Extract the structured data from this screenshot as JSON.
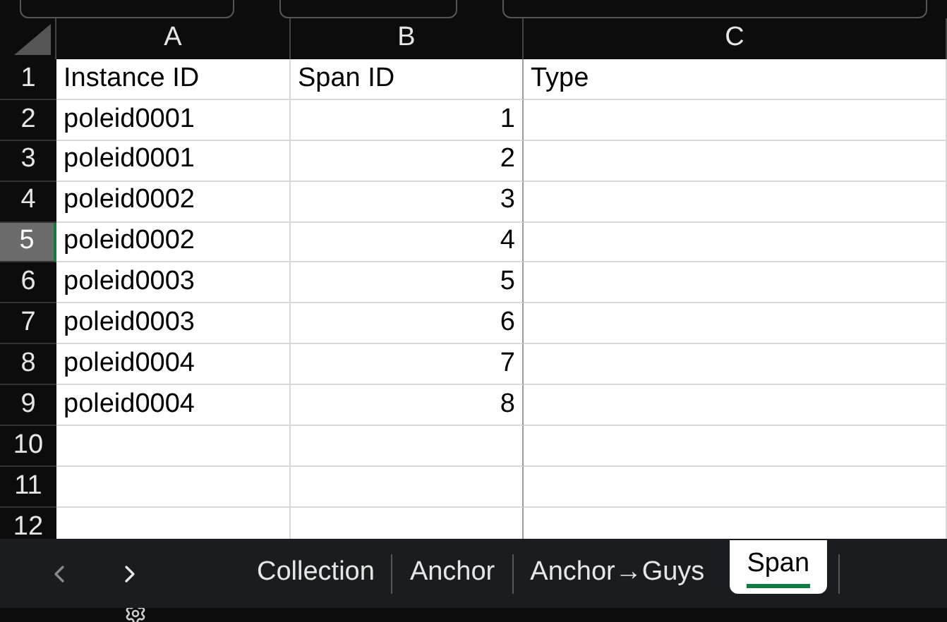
{
  "columns": [
    "A",
    "B",
    "C"
  ],
  "rows": [
    {
      "number": "1",
      "selected": false,
      "cells": [
        "Instance ID",
        "Span ID",
        "Type"
      ]
    },
    {
      "number": "2",
      "selected": false,
      "cells": [
        "poleid0001",
        "1",
        ""
      ]
    },
    {
      "number": "3",
      "selected": false,
      "cells": [
        "poleid0001",
        "2",
        ""
      ]
    },
    {
      "number": "4",
      "selected": false,
      "cells": [
        "poleid0002",
        "3",
        ""
      ]
    },
    {
      "number": "5",
      "selected": true,
      "cells": [
        "poleid0002",
        "4",
        ""
      ]
    },
    {
      "number": "6",
      "selected": false,
      "cells": [
        "poleid0003",
        "5",
        ""
      ]
    },
    {
      "number": "7",
      "selected": false,
      "cells": [
        "poleid0003",
        "6",
        ""
      ]
    },
    {
      "number": "8",
      "selected": false,
      "cells": [
        "poleid0004",
        "7",
        ""
      ]
    },
    {
      "number": "9",
      "selected": false,
      "cells": [
        "poleid0004",
        "8",
        ""
      ]
    },
    {
      "number": "10",
      "selected": false,
      "cells": [
        "",
        "",
        ""
      ]
    },
    {
      "number": "11",
      "selected": false,
      "cells": [
        "",
        "",
        ""
      ]
    },
    {
      "number": "12",
      "selected": false,
      "cells": [
        "",
        "",
        ""
      ]
    }
  ],
  "sheet_tabs": [
    {
      "label": "Collection",
      "selected": false
    },
    {
      "label": "Anchor",
      "selected": false
    },
    {
      "label": "Anchor→Guys",
      "selected": false
    },
    {
      "label": "Span",
      "selected": true
    }
  ]
}
